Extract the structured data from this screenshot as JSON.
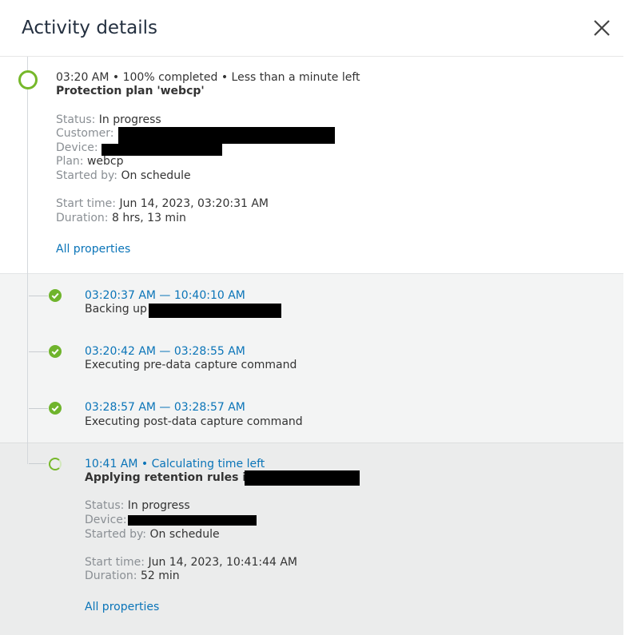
{
  "header": {
    "title": "Activity details"
  },
  "main": {
    "summary": "03:20 AM • 100% completed • Less than a minute left",
    "name": "Protection plan 'webcp'",
    "status_label": "Status:",
    "status_value": "In progress",
    "customer_label": "Customer:",
    "device_label": "Device:",
    "plan_label": "Plan:",
    "plan_value": "webcp",
    "started_by_label": "Started by:",
    "started_by_value": "On schedule",
    "start_time_label": "Start time:",
    "start_time_value": "Jun 14, 2023, 03:20:31 AM",
    "duration_label": "Duration:",
    "duration_value": "8 hrs, 13 min",
    "all_properties": "All properties"
  },
  "steps": [
    {
      "time": "03:20:37 AM — 10:40:10 AM",
      "desc": "Backing up"
    },
    {
      "time": "03:20:42 AM — 03:28:55 AM",
      "desc": "Executing pre-data capture command"
    },
    {
      "time": "03:28:57 AM — 03:28:57 AM",
      "desc": "Executing post-data capture command"
    }
  ],
  "current": {
    "summary": "10:41 AM • Calculating time left",
    "name": "Applying retention rules in",
    "status_label": "Status:",
    "status_value": "In progress",
    "device_label": "Device:",
    "started_by_label": "Started by:",
    "started_by_value": "On schedule",
    "start_time_label": "Start time:",
    "start_time_value": "Jun 14, 2023, 10:41:44 AM",
    "duration_label": "Duration:",
    "duration_value": "52 min",
    "all_properties": "All properties"
  },
  "colors": {
    "accent_green": "#76b82a",
    "link_blue": "#0a74b8"
  }
}
